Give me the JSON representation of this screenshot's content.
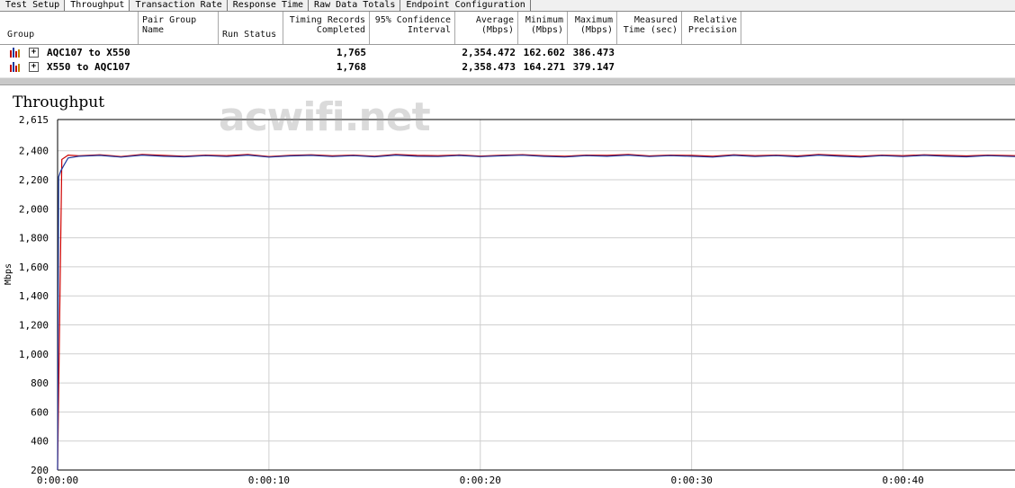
{
  "tabs": [
    {
      "label": "Test Setup",
      "active": false
    },
    {
      "label": "Throughput",
      "active": true
    },
    {
      "label": "Transaction Rate",
      "active": false
    },
    {
      "label": "Response Time",
      "active": false
    },
    {
      "label": "Raw Data Totals",
      "active": false
    },
    {
      "label": "Endpoint Configuration",
      "active": false
    }
  ],
  "grid": {
    "headers": {
      "group": "Group",
      "pair_group_name": [
        "Pair Group",
        "Name"
      ],
      "run_status": "Run Status",
      "timing_records": [
        "Timing Records",
        "Completed"
      ],
      "confidence": [
        "95% Confidence",
        "Interval"
      ],
      "average": [
        "Average",
        "(Mbps)"
      ],
      "minimum": [
        "Minimum",
        "(Mbps)"
      ],
      "maximum": [
        "Maximum",
        "(Mbps)"
      ],
      "measured_time": [
        "Measured",
        "Time (sec)"
      ],
      "relative_precision": [
        "Relative",
        "Precision"
      ]
    },
    "rows": [
      {
        "pair": "AQC107 to X550",
        "records": "1,765",
        "average": "2,354.472",
        "minimum": "162.602",
        "maximum": "386.473"
      },
      {
        "pair": "X550 to AQC107",
        "records": "1,768",
        "average": "2,358.473",
        "minimum": "164.271",
        "maximum": "379.147"
      }
    ]
  },
  "watermark": "acwifi.net",
  "chart_data": {
    "type": "line",
    "title": "Throughput",
    "ylabel": "Mbps",
    "xlabel": "",
    "ylim": [
      200,
      2615
    ],
    "yticks": [
      "2,615",
      "2,400",
      "2,200",
      "2,000",
      "1,800",
      "1,600",
      "1,400",
      "1,200",
      "1,000",
      "800",
      "600",
      "400",
      "200"
    ],
    "ytick_values": [
      2615,
      2400,
      2200,
      2000,
      1800,
      1600,
      1400,
      1200,
      1000,
      800,
      600,
      400,
      200
    ],
    "xticks": [
      "0:00:00",
      "0:00:10",
      "0:00:20",
      "0:00:30",
      "0:00:40"
    ],
    "xtick_values": [
      0,
      10,
      20,
      30,
      40
    ],
    "xlim": [
      0,
      45.3
    ],
    "grid": true,
    "series": [
      {
        "color": "#cc0000",
        "x": [
          0,
          0.2,
          0.5,
          1,
          2,
          3,
          4,
          5,
          6,
          7,
          8,
          9,
          10,
          11,
          12,
          13,
          14,
          15,
          16,
          17,
          18,
          19,
          20,
          21,
          22,
          23,
          24,
          25,
          26,
          27,
          28,
          29,
          30,
          31,
          32,
          33,
          34,
          35,
          36,
          37,
          38,
          39,
          40,
          41,
          42,
          43,
          44,
          45.3
        ],
        "values": [
          200,
          2340,
          2370,
          2365,
          2372,
          2360,
          2375,
          2368,
          2362,
          2370,
          2366,
          2374,
          2360,
          2368,
          2372,
          2365,
          2370,
          2362,
          2374,
          2368,
          2366,
          2371,
          2363,
          2369,
          2373,
          2366,
          2362,
          2370,
          2368,
          2374,
          2364,
          2370,
          2368,
          2362,
          2372,
          2366,
          2370,
          2364,
          2374,
          2368,
          2362,
          2370,
          2366,
          2372,
          2368,
          2364,
          2370,
          2366
        ]
      },
      {
        "color": "#1f3a9f",
        "x": [
          0,
          0.05,
          0.15,
          0.3,
          0.5,
          1,
          2,
          3,
          4,
          5,
          6,
          7,
          8,
          9,
          10,
          11,
          12,
          13,
          14,
          15,
          16,
          17,
          18,
          19,
          20,
          21,
          22,
          23,
          24,
          25,
          26,
          27,
          28,
          29,
          30,
          31,
          32,
          33,
          34,
          35,
          36,
          37,
          38,
          39,
          40,
          41,
          42,
          43,
          44,
          45.3
        ],
        "values": [
          200,
          2220,
          2260,
          2300,
          2350,
          2362,
          2368,
          2356,
          2370,
          2362,
          2358,
          2366,
          2360,
          2370,
          2356,
          2364,
          2368,
          2360,
          2366,
          2358,
          2370,
          2362,
          2360,
          2367,
          2359,
          2365,
          2369,
          2361,
          2357,
          2366,
          2362,
          2370,
          2360,
          2366,
          2362,
          2356,
          2368,
          2360,
          2366,
          2358,
          2370,
          2362,
          2356,
          2366,
          2360,
          2368,
          2362,
          2358,
          2366,
          2360
        ]
      }
    ]
  }
}
